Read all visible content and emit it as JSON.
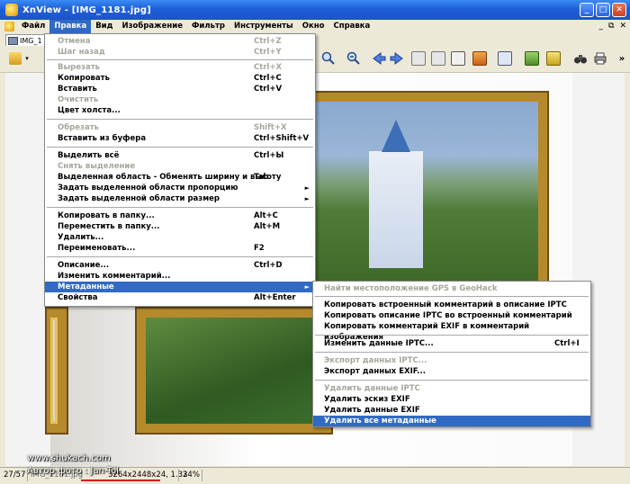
{
  "window": {
    "title": "XnView - [IMG_1181.jpg]",
    "controls": {
      "minimize": "_",
      "maximize": "□",
      "close": "✕"
    }
  },
  "menubar": {
    "items": [
      "Файл",
      "Правка",
      "Вид",
      "Изображение",
      "Фильтр",
      "Инструменты",
      "Окно",
      "Справка"
    ],
    "active_index": 1,
    "mdi_controls": [
      "_",
      "⧉",
      "✕"
    ]
  },
  "tab": {
    "label": "IMG_1"
  },
  "toolbar": {
    "icons": [
      "browse-icon",
      "dropdown-arrow-icon",
      "zoom-in-icon",
      "zoom-out-icon",
      "previous-icon",
      "next-icon",
      "fit-icon",
      "actual-size-icon",
      "fullscreen-icon",
      "slideshow-icon",
      "rotate-icon",
      "properties-icon",
      "convert-icon",
      "binoculars-icon",
      "print-icon",
      "more-icon"
    ],
    "more_label": "»"
  },
  "edit_menu": {
    "items": [
      {
        "label": "Отмена",
        "shortcut": "Ctrl+Z",
        "disabled": true
      },
      {
        "label": "Шаг назад",
        "shortcut": "Ctrl+Y",
        "disabled": true
      },
      {
        "label": "Вырезать",
        "shortcut": "Ctrl+X",
        "disabled": true
      },
      {
        "label": "Копировать",
        "shortcut": "Ctrl+C",
        "disabled": false
      },
      {
        "label": "Вставить",
        "shortcut": "Ctrl+V",
        "disabled": false
      },
      {
        "label": "Очистить",
        "shortcut": "",
        "disabled": true
      },
      {
        "label": "Цвет холста...",
        "shortcut": "",
        "disabled": false
      },
      {
        "label": "Обрезать",
        "shortcut": "Shift+X",
        "disabled": true
      },
      {
        "label": "Вставить из буфера",
        "shortcut": "Ctrl+Shift+V",
        "disabled": false
      },
      {
        "label": "Выделить всё",
        "shortcut": "Ctrl+Ы",
        "disabled": false
      },
      {
        "label": "Снять выделение",
        "shortcut": "",
        "disabled": true
      },
      {
        "label": "Выделенная область - Обменять ширину и высоту",
        "shortcut": "Tab",
        "disabled": false
      },
      {
        "label": "Задать выделенной области пропорцию",
        "shortcut": "",
        "disabled": false,
        "submenu": true
      },
      {
        "label": "Задать выделенной области размер",
        "shortcut": "",
        "disabled": false,
        "submenu": true
      },
      {
        "label": "Копировать в папку...",
        "shortcut": "Alt+C",
        "disabled": false
      },
      {
        "label": "Переместить в папку...",
        "shortcut": "Alt+M",
        "disabled": false
      },
      {
        "label": "Удалить...",
        "shortcut": "",
        "disabled": false
      },
      {
        "label": "Переименовать...",
        "shortcut": "F2",
        "disabled": false
      },
      {
        "label": "Описание...",
        "shortcut": "Ctrl+D",
        "disabled": false
      },
      {
        "label": "Изменить комментарий...",
        "shortcut": "",
        "disabled": false
      },
      {
        "label": "Метаданные",
        "shortcut": "",
        "disabled": false,
        "submenu": true,
        "highlighted": true
      },
      {
        "label": "Свойства",
        "shortcut": "Alt+Enter",
        "disabled": false
      }
    ],
    "submenu_arrow": "►"
  },
  "metadata_submenu": {
    "items": [
      {
        "label": "Найти местоположение GPS в GeoHack",
        "shortcut": "",
        "disabled": true
      },
      {
        "label": "Копировать встроенный комментарий в описание IPTC",
        "shortcut": "",
        "disabled": false
      },
      {
        "label": "Копировать описание IPTC во встроенный комментарий",
        "shortcut": "",
        "disabled": false
      },
      {
        "label": "Копировать комментарий EXIF в комментарий изображения",
        "shortcut": "",
        "disabled": false
      },
      {
        "label": "Изменить данные IPTC...",
        "shortcut": "Ctrl+I",
        "disabled": false
      },
      {
        "label": "Экспорт данных IPTC...",
        "shortcut": "",
        "disabled": true
      },
      {
        "label": "Экспорт данных EXIF...",
        "shortcut": "",
        "disabled": false
      },
      {
        "label": "Удалить данные IPTC",
        "shortcut": "",
        "disabled": true
      },
      {
        "label": "Удалить эскиз EXIF",
        "shortcut": "",
        "disabled": false
      },
      {
        "label": "Удалить данные EXIF",
        "shortcut": "",
        "disabled": false
      },
      {
        "label": "Удалить все метаданные",
        "shortcut": "",
        "disabled": false,
        "highlighted": true
      }
    ]
  },
  "statusbar": {
    "position": "27/57",
    "file_info": "IMG_1181.jpg",
    "dimensions": "3264x2448x24, 1.33",
    "zoom": "24%"
  },
  "watermark": {
    "site": "www.shukach.com",
    "author": "Автор фото : Jan-Tol"
  },
  "colors": {
    "highlight": "#316ac5",
    "titlebar": "#1f5fd8",
    "disabled_text": "#a7a59c"
  }
}
